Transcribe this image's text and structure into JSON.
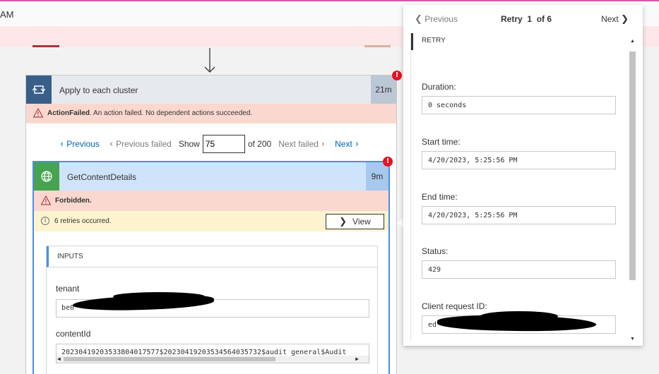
{
  "top": {
    "label": "AM"
  },
  "outer": {
    "title": "Apply to each cluster",
    "duration": "21m",
    "badge": "!",
    "error_code": "ActionFailed",
    "error_text": ". An action failed. No dependent actions succeeded."
  },
  "pager": {
    "previous": "Previous",
    "previous_failed": "Previous failed",
    "show": "Show",
    "value": "75",
    "of": "of 200",
    "next_failed": "Next failed",
    "next": "Next"
  },
  "inner": {
    "title": "GetContentDetails",
    "duration": "9m",
    "badge": "!",
    "error": "Forbidden.",
    "retries": "6 retries occurred.",
    "view": "View",
    "inputs_header": "INPUTS",
    "fields": {
      "tenant_label": "tenant",
      "tenant_value": "be0",
      "content_label": "contentId",
      "content_value": "20230419203533804017577$20230419203534564035732$audit_general$Audit"
    }
  },
  "panel": {
    "previous": "Previous",
    "retry_label": "Retry",
    "retry_index": "1",
    "retry_total": "of 6",
    "next": "Next",
    "section": "RETRY",
    "duration_label": "Duration:",
    "duration_value": "0 seconds",
    "start_label": "Start time:",
    "start_value": "4/20/2023, 5:25:56 PM",
    "end_label": "End time:",
    "end_value": "4/20/2023, 5:25:56 PM",
    "status_label": "Status:",
    "status_value": "429",
    "client_label": "Client request ID:",
    "client_value": "ed"
  },
  "icons": {
    "loop": "loop-icon",
    "globe": "globe-icon",
    "warning": "warning-icon",
    "info": "info-icon",
    "arrow": "down-arrow-icon"
  },
  "colors": {
    "loop_icon_bg": "#385e8a",
    "action_icon_bg": "#46a350",
    "error_bg": "#fbd8cf",
    "warning_bg": "#fdf4cf",
    "link": "#0063b1",
    "badge": "#e81123"
  }
}
